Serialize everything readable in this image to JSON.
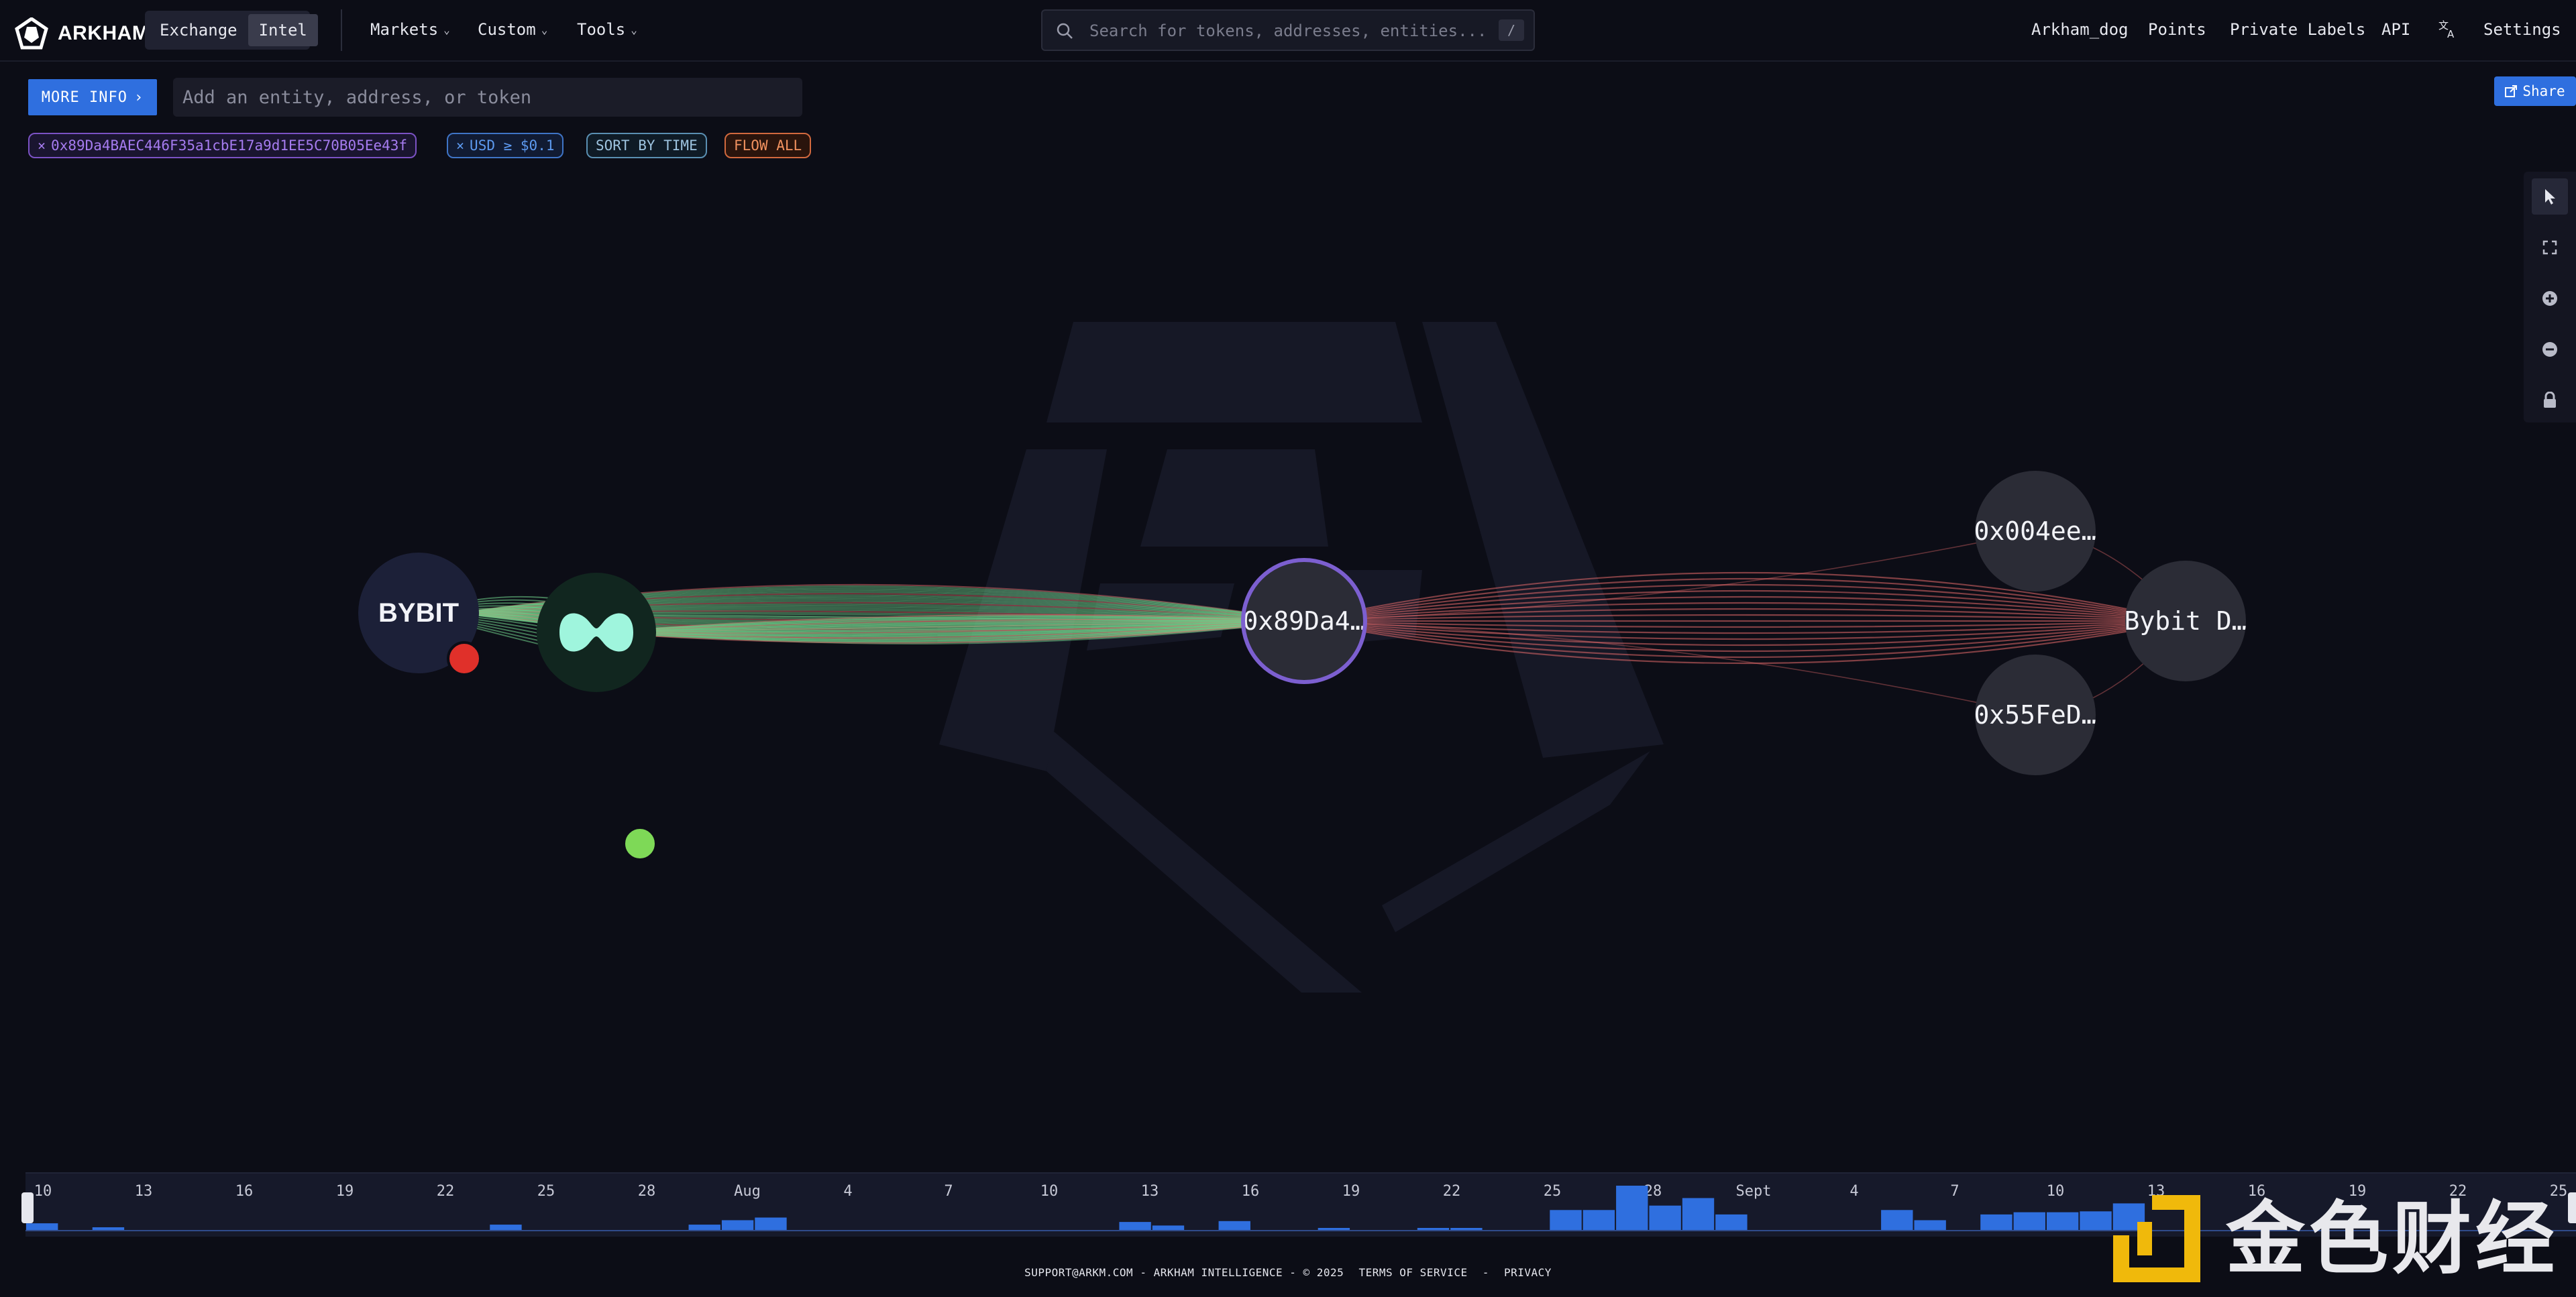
{
  "header": {
    "logo_text": "ARKHAM",
    "modes": [
      "Exchange",
      "Intel"
    ],
    "active_mode": "Intel",
    "nav": [
      {
        "label": "Markets",
        "icon": "chevron-down-icon"
      },
      {
        "label": "Custom",
        "icon": "chevron-down-icon"
      },
      {
        "label": "Tools",
        "icon": "chevron-down-icon"
      }
    ],
    "search_placeholder": "Search for tokens, addresses, entities...",
    "search_shortcut": "/",
    "links": [
      "Arkham_dog",
      "Points",
      "Private Labels",
      "API"
    ],
    "translate_icon": "translate-icon",
    "settings_label": "Settings"
  },
  "filters": {
    "more_info_label": "MORE INFO",
    "add_placeholder": "Add an entity, address, or token",
    "chips": [
      {
        "label": "0x89Da4BAEC446F35a1cbE17a9d1EE5C70B05Ee43f",
        "closable": true,
        "color": "#9a6ae6"
      },
      {
        "label": "USD ≥ $0.1",
        "closable": true,
        "color": "#4a8de6"
      },
      {
        "label": "SORT BY TIME",
        "closable": false,
        "color": "#8fb8d8"
      },
      {
        "label": "FLOW ALL",
        "closable": false,
        "color": "#f08a5d"
      }
    ],
    "share_label": "Share"
  },
  "toolbar": {
    "tools": [
      "cursor-icon",
      "fit-screen-icon",
      "zoom-in-icon",
      "zoom-out-icon",
      "lock-icon"
    ],
    "active_tool": "cursor-icon"
  },
  "graph": {
    "nodes": [
      {
        "id": "bybit",
        "label": "BYBIT",
        "status_color": "#e0302a"
      },
      {
        "id": "hyperliquid",
        "label": "",
        "status_color": "#7ed957"
      },
      {
        "id": "center",
        "label": "0x89Da4…"
      },
      {
        "id": "n004",
        "label": "0x004ee…"
      },
      {
        "id": "bybitd",
        "label": "Bybit D…"
      },
      {
        "id": "n55f",
        "label": "0x55FeD…"
      }
    ],
    "edge_colors": {
      "inflow": "#6fcf8a",
      "outflow": "#e26a6a"
    }
  },
  "timeline": {
    "ticks": [
      "10",
      "13",
      "16",
      "19",
      "22",
      "25",
      "28",
      "Aug",
      "4",
      "7",
      "10",
      "13",
      "16",
      "19",
      "22",
      "25",
      "28",
      "Sept",
      "4",
      "7",
      "10",
      "13",
      "16",
      "19",
      "22",
      "25"
    ],
    "bars": [
      0.15,
      0,
      0.06,
      0,
      0,
      0,
      0,
      0,
      0,
      0,
      0,
      0,
      0,
      0,
      0.12,
      0,
      0,
      0,
      0,
      0,
      0.12,
      0.22,
      0.28,
      0,
      0,
      0,
      0,
      0,
      0,
      0,
      0,
      0,
      0,
      0.18,
      0.1,
      0,
      0.2,
      0,
      0,
      0.04,
      0,
      0,
      0.04,
      0.04,
      0,
      0,
      0.45,
      0.45,
      1.0,
      0.55,
      0.72,
      0.35,
      0,
      0,
      0,
      0,
      0.45,
      0.22,
      0,
      0.35,
      0.4,
      0.4,
      0.42,
      0.6,
      0,
      0,
      0,
      0,
      0,
      0,
      0,
      0,
      0,
      0,
      0,
      0,
      0
    ],
    "bar_color": "#2f6fdf"
  },
  "footer": {
    "support": "SUPPORT@ARKM.COM - ARKHAM INTELLIGENCE - © 2025",
    "terms": "TERMS OF SERVICE",
    "sep": "-",
    "privacy": "PRIVACY"
  },
  "watermark": {
    "text": "金色财经"
  }
}
